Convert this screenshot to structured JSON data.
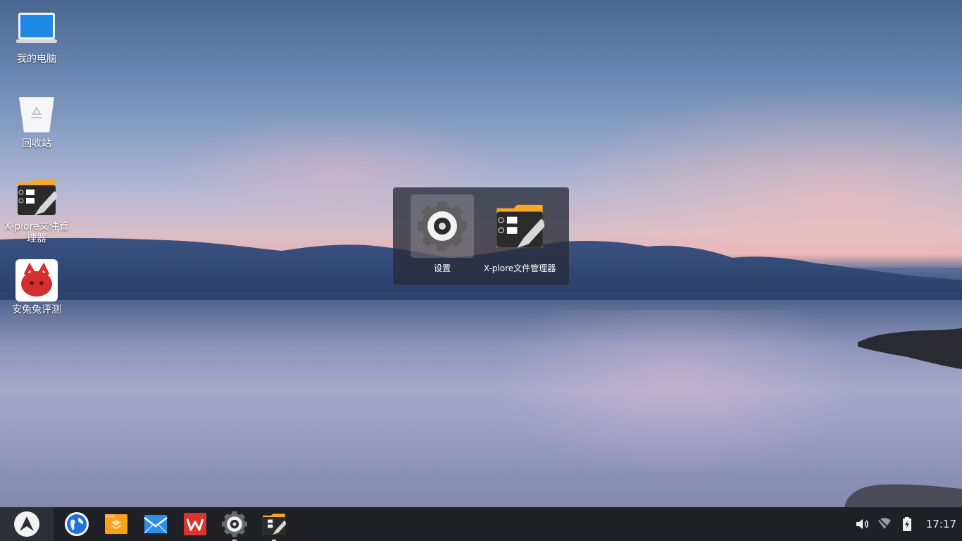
{
  "desktop": {
    "icons": [
      {
        "label": "我的电脑",
        "icon": "computer-icon"
      },
      {
        "label": "回收站",
        "icon": "recycle-bin-icon"
      },
      {
        "label": "X-plore文件管理器",
        "icon": "xplore-file-manager-icon"
      },
      {
        "label": "安兔兔评测",
        "icon": "antutu-icon"
      }
    ]
  },
  "folder_popup": {
    "apps": [
      {
        "label": "设置",
        "icon": "settings-gear-icon",
        "selected": true
      },
      {
        "label": "X-plore文件管理器",
        "icon": "xplore-file-manager-icon",
        "selected": false
      }
    ]
  },
  "taskbar": {
    "start_icon": "start-menu-icon",
    "items": [
      {
        "name": "browser",
        "icon": "globe-browser-icon"
      },
      {
        "name": "files",
        "icon": "file-manager-icon"
      },
      {
        "name": "mail",
        "icon": "mail-icon"
      },
      {
        "name": "wps",
        "icon": "wps-office-icon"
      },
      {
        "name": "settings",
        "icon": "settings-gear-icon",
        "running": true
      },
      {
        "name": "xplore",
        "icon": "xplore-file-manager-icon",
        "running": true
      }
    ],
    "tray": {
      "volume_icon": "volume-icon",
      "wifi_icon": "wifi-off-icon",
      "battery_icon": "battery-charging-icon",
      "clock": "17:17"
    }
  },
  "colors": {
    "taskbar_bg": "#1f2127",
    "start_bg": "#2c2f36",
    "popup_bg": "rgba(40,44,58,0.78)"
  }
}
